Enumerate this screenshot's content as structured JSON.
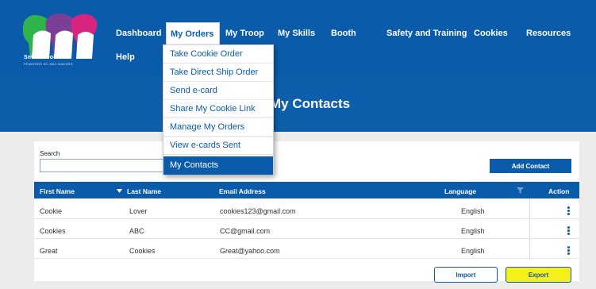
{
  "app": {
    "logo_text": "Smart Cookies",
    "logo_sub": "POWERED BY ABC BAKERS"
  },
  "nav": {
    "items": [
      "Dashboard",
      "My Orders",
      "My Troop",
      "My Skills",
      "Booth",
      "Safety and Training",
      "Cookies",
      "Resources",
      "Help"
    ],
    "active": "My Orders"
  },
  "dropdown": {
    "items": [
      "Take Cookie Order",
      "Take Direct Ship Order",
      "Send e-card",
      "Share My Cookie Link",
      "Manage My Orders",
      "View e-cards Sent",
      "My Contacts"
    ],
    "selected": "My Contacts"
  },
  "page": {
    "title": "My Contacts"
  },
  "search": {
    "label": "Search",
    "value": "",
    "placeholder": ""
  },
  "buttons": {
    "add_contact": "Add Contact",
    "import": "Import",
    "export": "Export"
  },
  "table": {
    "columns": [
      "First Name",
      "Last Name",
      "Email Address",
      "Language",
      "Action"
    ],
    "rows": [
      [
        "Cookie",
        "Lover",
        "cookies123@gmail.com",
        "English"
      ],
      [
        "Cookies",
        "ABC",
        "CC@gmail.com",
        "English"
      ],
      [
        "Great",
        "Cookies",
        "Great@yahoo.com",
        "English"
      ]
    ]
  },
  "icons": {
    "sort": "triangle-down-icon",
    "filter": "filter-icon",
    "row_action": "kebab-menu-icon"
  },
  "colors": {
    "brand_blue": "#0a5cab",
    "highlight_yellow": "#f7ef19",
    "logo_green": "#2fb44b",
    "logo_purple": "#7b3f98",
    "logo_pink": "#d6247f"
  }
}
